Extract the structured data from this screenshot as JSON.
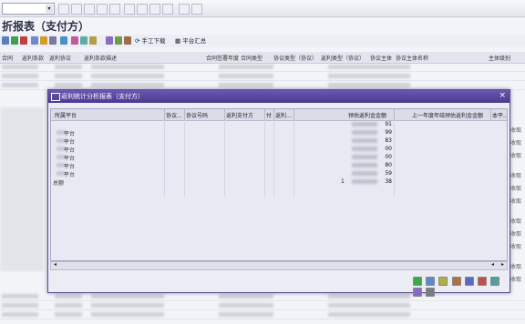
{
  "window": {
    "title": "折报表（支付方）"
  },
  "toolbar": {
    "manual_download_label": "手工下载",
    "platform_summary_label": "平台汇总"
  },
  "background_grid": {
    "headers": [
      "合同",
      "返利条款",
      "返利协议",
      "返利条款描述",
      "合同签署年度",
      "合同类型",
      "协议类型（协议）",
      "返利类型（协议）",
      "协议主体",
      "协议主体名称",
      "主体级别"
    ],
    "right_column_values": [
      "收取",
      "收取",
      "收取",
      "收取",
      "收取",
      "收取",
      "收取",
      "收取",
      "收取",
      "收取",
      "收取"
    ]
  },
  "dialog": {
    "title": "返利统计分析报表（支付方）",
    "close_label": "×",
    "headers": [
      "所属平台",
      "协议...",
      "协议号码",
      "返利支付方",
      "付",
      "返利...",
      "预估返利金金额",
      "上一年度年结预估返利金金额",
      "本平..."
    ],
    "rows": [
      {
        "platform": "",
        "value": "91"
      },
      {
        "platform": "平台",
        "value": "99"
      },
      {
        "platform": "平台",
        "value": "83"
      },
      {
        "platform": "平台",
        "value": "00"
      },
      {
        "platform": "平台",
        "value": "00"
      },
      {
        "platform": "平台",
        "value": "80"
      },
      {
        "platform": "平台",
        "value": "59"
      }
    ],
    "total": {
      "label": "总额",
      "prefix": "1",
      "value": "38"
    }
  }
}
